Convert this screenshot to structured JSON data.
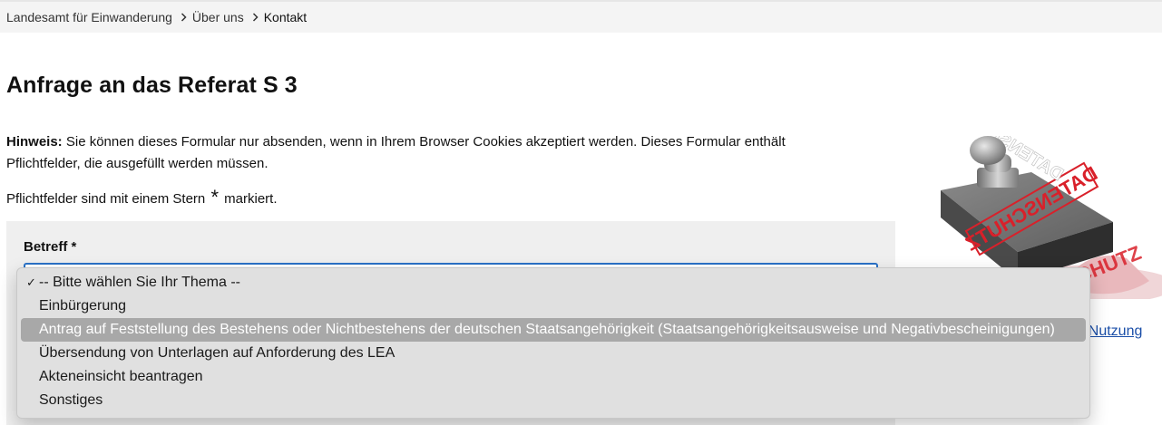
{
  "breadcrumb": {
    "items": [
      {
        "label": "Landesamt für Einwanderung"
      },
      {
        "label": "Über uns"
      },
      {
        "label": "Kontakt"
      }
    ]
  },
  "page_title": "Anfrage an das Referat S 3",
  "hint": {
    "label": "Hinweis:",
    "text": " Sie können dieses Formular nur absenden, wenn in Ihrem Browser Cookies akzeptiert werden. Dieses Formular enthält Pflichtfelder, die ausgefüllt werden müssen."
  },
  "required_note": {
    "before": "Pflichtfelder sind mit einem Stern ",
    "star": "*",
    "after": " markiert."
  },
  "form": {
    "subject_label": "Betreff *",
    "subject_options": [
      {
        "label": "-- Bitte wählen Sie Ihr Thema --",
        "selected": true
      },
      {
        "label": "Einbürgerung"
      },
      {
        "label": "Antrag auf Feststellung des Bestehens oder Nichtbestehens der deutschen Staatsangehörigkeit (Staatsangehörigkeitsausweise und Negativbescheinigungen)",
        "highlighted": true
      },
      {
        "label": "Übersendung von Unterlagen auf Anforderung des LEA"
      },
      {
        "label": "Akteneinsicht beantragen"
      },
      {
        "label": "Sonstiges"
      }
    ],
    "check_glyph": "✓"
  },
  "sidebar": {
    "image_icon": "datenschutz-stamp-icon",
    "stamp_text": "DATENSCHUTZ",
    "stamp_text_partial": "SCHUTZ",
    "link_text": "r Nutzung"
  },
  "colors": {
    "focus_border": "#2a72c7",
    "link": "#1a4ea8",
    "stamp_red": "#d9202a"
  }
}
